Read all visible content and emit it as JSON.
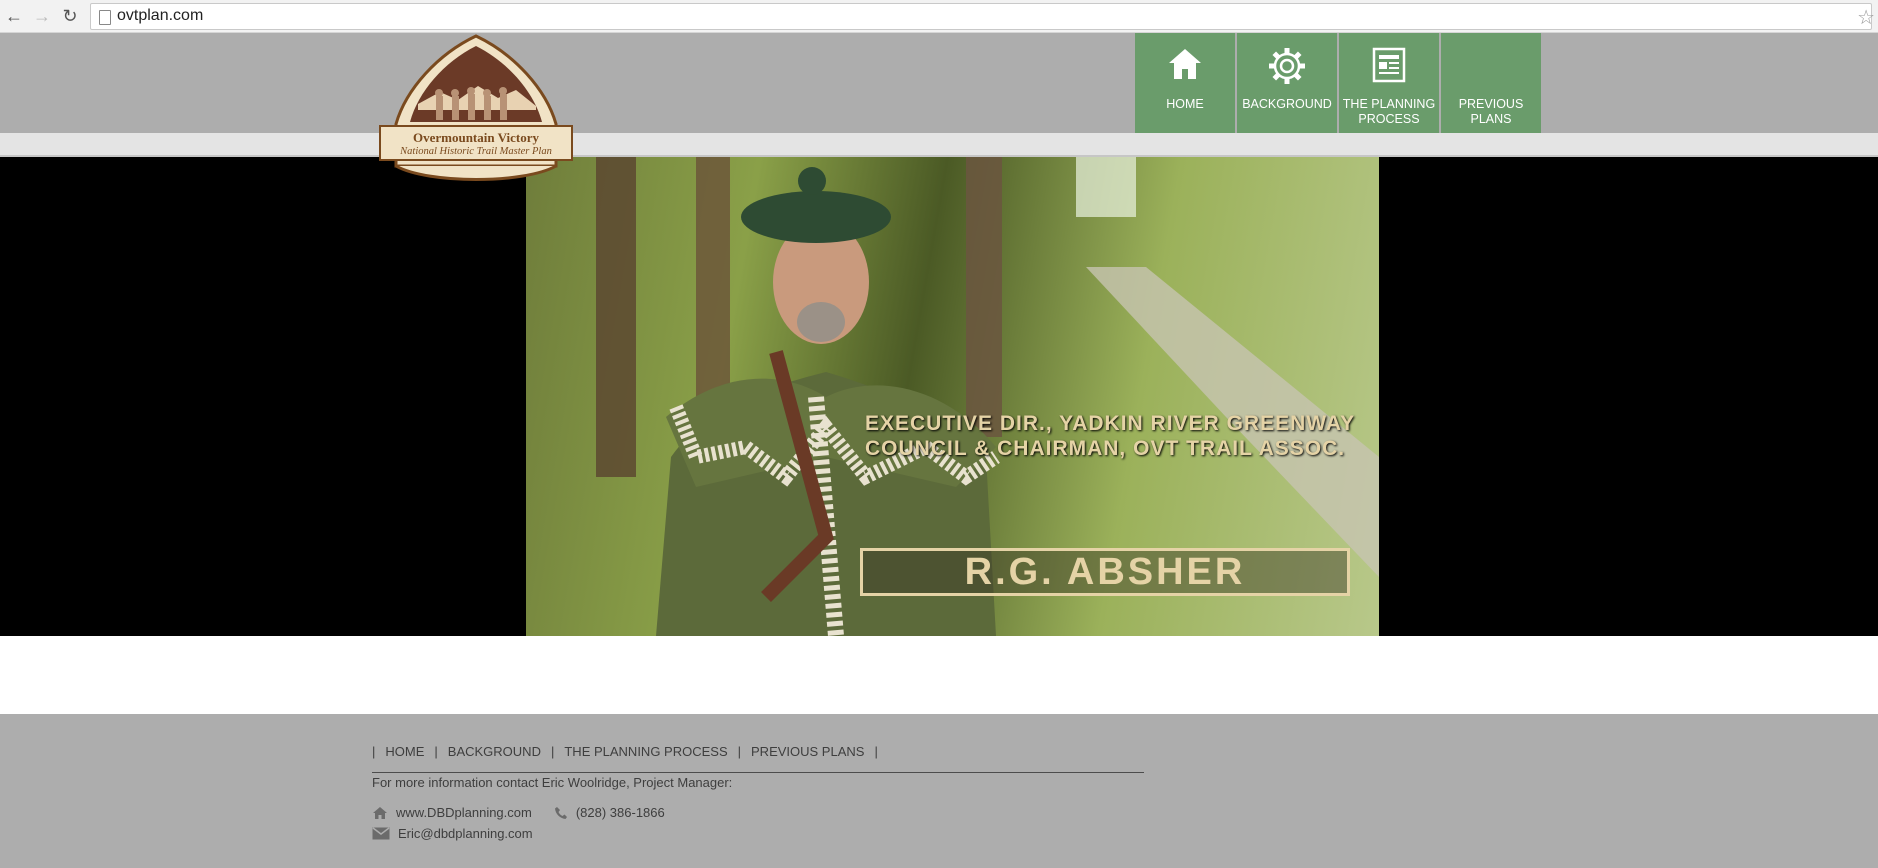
{
  "browser": {
    "url": "ovtplan.com",
    "back_glyph": "←",
    "forward_glyph": "→",
    "reload_glyph": "↻",
    "star_glyph": "☆"
  },
  "logo": {
    "line1": "Overmountain Victory",
    "line2": "National Historic Trail Master Plan"
  },
  "nav": [
    {
      "label": "HOME",
      "icon": "home-icon"
    },
    {
      "label": "BACKGROUND",
      "icon": "gear-icon"
    },
    {
      "label": "THE PLANNING PROCESS",
      "icon": "document-icon"
    },
    {
      "label": "PREVIOUS PLANS",
      "icon": ""
    }
  ],
  "video": {
    "caption_line1": "EXECUTIVE DIR., YADKIN RIVER GREENWAY",
    "caption_line2": "COUNCIL & CHAIRMAN, OVT TRAIL ASSOC.",
    "name": "R.G. ABSHER"
  },
  "footer": {
    "nav": [
      "HOME",
      "BACKGROUND",
      "THE PLANNING PROCESS",
      "PREVIOUS PLANS"
    ],
    "contact_note": "For more information contact Eric Woolridge, Project Manager:",
    "website": "www.DBDplanning.com",
    "phone": "(828) 386-1866",
    "email": "Eric@dbdplanning.com"
  },
  "colors": {
    "nav_green": "#6a9c6b",
    "header_gray": "#adadad",
    "caption_tan": "#e5d3a6"
  }
}
